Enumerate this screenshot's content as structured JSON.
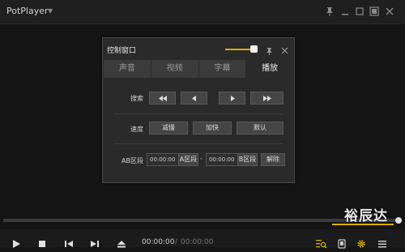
{
  "app": {
    "name": "PotPlayer"
  },
  "panel": {
    "title": "控制窗口",
    "tabs": [
      {
        "label": "声音",
        "active": false
      },
      {
        "label": "视频",
        "active": false
      },
      {
        "label": "字幕",
        "active": false
      },
      {
        "label": "播放",
        "active": true
      }
    ],
    "search": {
      "label": "搜索"
    },
    "speed": {
      "label": "速度",
      "slower": "减慢",
      "faster": "加快",
      "default": "默认"
    },
    "ab": {
      "label": "AB区段",
      "a_time": "00:00:00",
      "a_btn": "A区段",
      "dash": "-",
      "b_time": "00:00:00",
      "b_btn": "B区段",
      "remove": "解除"
    }
  },
  "playback": {
    "current_time": "00:00:00",
    "separator": "/",
    "total_time": "00:00:00"
  },
  "watermark": "裕辰达",
  "colors": {
    "accent": "#d9b000",
    "background": "#141414",
    "panel": "#2a2a2a"
  }
}
